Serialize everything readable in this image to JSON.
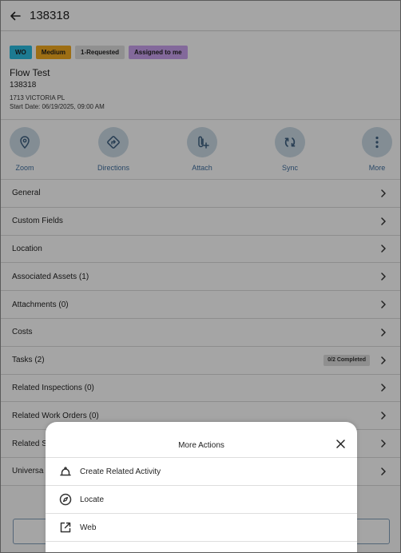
{
  "header": {
    "title": "138318",
    "back_icon": "arrow-left-icon"
  },
  "summary": {
    "badges": [
      "WO",
      "Medium",
      "1-Requested",
      "Assigned to me"
    ],
    "badge_colors": {
      "wo": "#2ab6d9",
      "medium": "#eba41e",
      "requested": "#d7d7d7",
      "assigned": "#c49de8"
    },
    "title": "Flow Test",
    "id": "138318",
    "address": "1713 VICTORIA PL",
    "start_date": "Start Date: 06/19/2025, 09:00 AM"
  },
  "actions": [
    {
      "label": "Zoom",
      "icon": "map-pin-icon"
    },
    {
      "label": "Directions",
      "icon": "directions-icon"
    },
    {
      "label": "Attach",
      "icon": "attach-icon"
    },
    {
      "label": "Sync",
      "icon": "sync-icon"
    },
    {
      "label": "More",
      "icon": "more-vertical-icon"
    }
  ],
  "sections": [
    {
      "label": "General"
    },
    {
      "label": "Custom Fields"
    },
    {
      "label": "Location"
    },
    {
      "label": "Associated Assets (1)"
    },
    {
      "label": "Attachments (0)"
    },
    {
      "label": "Costs"
    },
    {
      "label": "Tasks (2)",
      "badge": "0/2 Completed"
    },
    {
      "label": "Related Inspections (0)"
    },
    {
      "label": "Related Work Orders (0)"
    },
    {
      "label": "Related S"
    },
    {
      "label": "Universa"
    }
  ],
  "sheet": {
    "title": "More Actions",
    "items": [
      {
        "label": "Create Related Activity",
        "icon": "create-activity-icon"
      },
      {
        "label": "Locate",
        "icon": "compass-icon"
      },
      {
        "label": "Web",
        "icon": "external-link-icon"
      }
    ]
  },
  "colors": {
    "accent": "#3d6a99",
    "action_circle": "#c3d2dd"
  }
}
